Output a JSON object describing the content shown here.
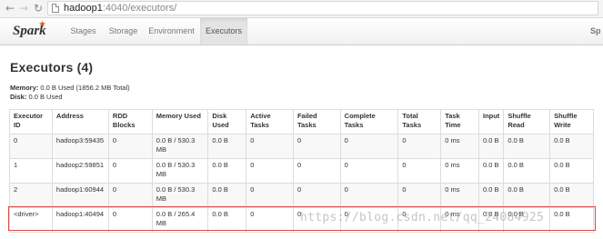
{
  "browser": {
    "url_host": "hadoop1",
    "url_rest": ":4040/executors/"
  },
  "navbar": {
    "brand": "Spark",
    "tabs": [
      {
        "label": "Stages"
      },
      {
        "label": "Storage"
      },
      {
        "label": "Environment"
      },
      {
        "label": "Executors",
        "active": true
      }
    ],
    "right_text": "Sp"
  },
  "page": {
    "title": "Executors (4)",
    "memory_label": "Memory:",
    "memory_value": "0.0 B Used (1856.2 MB Total)",
    "disk_label": "Disk:",
    "disk_value": "0.0 B Used"
  },
  "table": {
    "headers": [
      "Executor ID",
      "Address",
      "RDD Blocks",
      "Memory Used",
      "Disk Used",
      "Active Tasks",
      "Failed Tasks",
      "Complete Tasks",
      "Total Tasks",
      "Task Time",
      "Input",
      "Shuffle Read",
      "Shuffle Write"
    ],
    "rows": [
      [
        "0",
        "hadoop3:59435",
        "0",
        "0.0 B / 530.3 MB",
        "0.0 B",
        "0",
        "0",
        "0",
        "0",
        "0 ms",
        "0.0 B",
        "0.0 B",
        "0.0 B"
      ],
      [
        "1",
        "hadoop2:59851",
        "0",
        "0.0 B / 530.3 MB",
        "0.0 B",
        "0",
        "0",
        "0",
        "0",
        "0 ms",
        "0.0 B",
        "0.0 B",
        "0.0 B"
      ],
      [
        "2",
        "hadoop1:60944",
        "0",
        "0.0 B / 530.3 MB",
        "0.0 B",
        "0",
        "0",
        "0",
        "0",
        "0 ms",
        "0.0 B",
        "0.0 B",
        "0.0 B"
      ],
      [
        "<driver>",
        "hadoop1:40494",
        "0",
        "0.0 B / 265.4 MB",
        "0.0 B",
        "0",
        "0",
        "0",
        "0",
        "0 ms",
        "0.0 B",
        "0.0 B",
        "0.0 B"
      ]
    ]
  },
  "watermark": "https://blog.csdn.net/qq_24084925",
  "colors": {
    "highlight_border": "#d94a4a",
    "spark_orange": "#e25a1c"
  },
  "icons": [
    "back-arrow-icon",
    "forward-arrow-icon",
    "reload-icon",
    "page-icon"
  ]
}
